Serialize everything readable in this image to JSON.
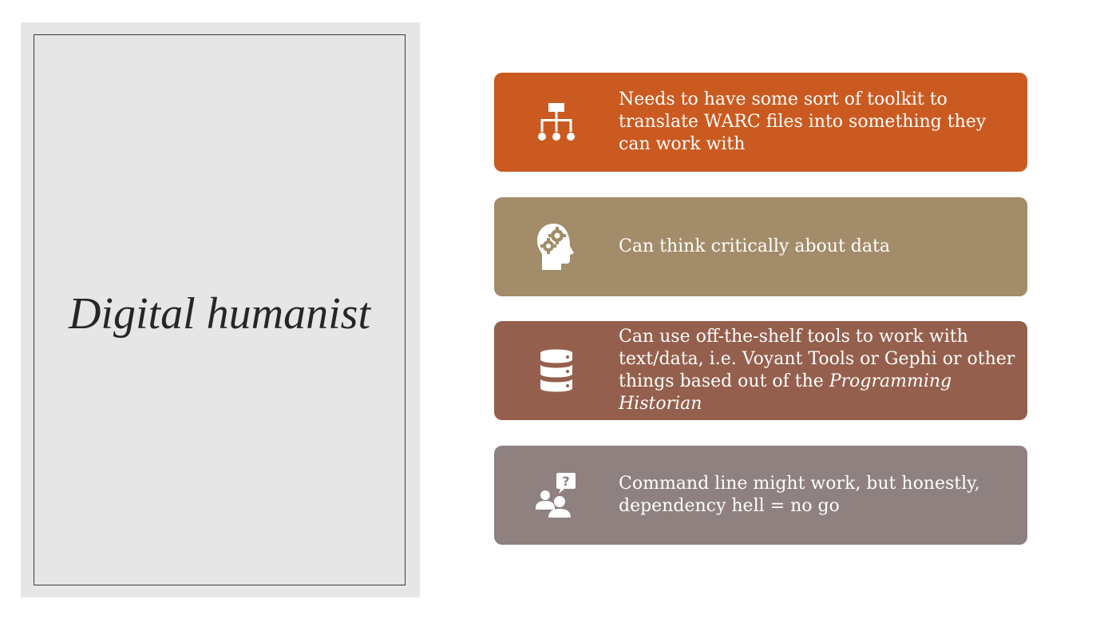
{
  "title": "Digital humanist",
  "cards": [
    {
      "icon": "hierarchy-icon",
      "color": "#cb5a20",
      "text": "Needs to have some sort of toolkit to translate WARC files into something they can work with"
    },
    {
      "icon": "head-gears-icon",
      "color": "#a38c69",
      "text": "Can think critically about data"
    },
    {
      "icon": "database-icon",
      "color": "#945f4c",
      "text_main": "Can use off-the-shelf tools to work with text/data, i.e. Voyant Tools or Gephi or other things based out of the ",
      "text_italic": "Programming Historian"
    },
    {
      "icon": "users-question-icon",
      "color": "#8e8180",
      "text": "Command line might work, but honestly, dependency hell = no go"
    }
  ]
}
